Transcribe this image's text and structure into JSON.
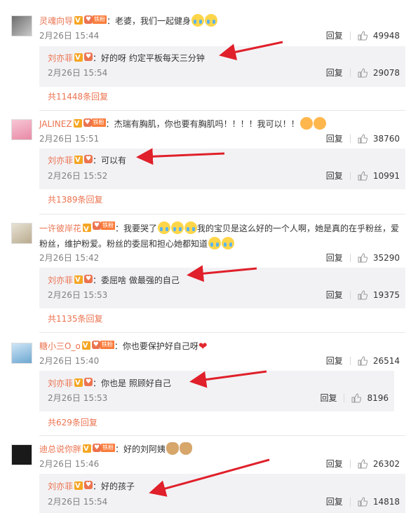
{
  "comments": [
    {
      "user": "灵魂向导",
      "sep": "：",
      "text": "老婆，我们一起健身",
      "emojis": [
        "cry",
        "cry"
      ],
      "time": "2月26日 15:44",
      "reply_label": "回复",
      "likes": "49948",
      "sub": {
        "user": "刘亦菲",
        "sep": "：",
        "text": "好的呀 约定平板每天三分钟",
        "time": "2月26日 15:54",
        "reply_label": "回复",
        "likes": "29078"
      },
      "more": "共11448条回复"
    },
    {
      "user": "JALINEZ",
      "sep": "：",
      "text": "杰瑞有胸肌，你也要有胸肌吗！！！！我可以！！",
      "emojis": [
        "sleep",
        "sleep"
      ],
      "time": "2月26日 15:51",
      "reply_label": "回复",
      "likes": "38760",
      "sub": {
        "user": "刘亦菲",
        "sep": "：",
        "text": "可以有",
        "time": "2月26日 15:52",
        "reply_label": "回复",
        "likes": "10991"
      },
      "more": "共1389条回复"
    },
    {
      "user": "一许彼岸花",
      "sep": "：",
      "text_a": "我要哭了",
      "text_b": "我的宝贝是这么好的一个人啊，她是真的在乎粉丝，爱粉丝，维护粉爱。粉丝的委屈和担心她都知道",
      "time": "2月26日 15:42",
      "reply_label": "回复",
      "likes": "35290",
      "sub": {
        "user": "刘亦菲",
        "sep": "：",
        "text": "委屈啥 做最强的自己",
        "time": "2月26日 15:53",
        "reply_label": "回复",
        "likes": "19375"
      },
      "more": "共1135条回复"
    },
    {
      "user": "糖小三O_o",
      "sep": "：",
      "text": "你也要保护好自己呀",
      "time": "2月26日 15:40",
      "reply_label": "回复",
      "likes": "26514",
      "sub": {
        "user": "刘亦菲",
        "sep": "：",
        "text": "你也是 照顾好自己",
        "time": "2月26日 15:53",
        "reply_label": "回复",
        "likes": "8196"
      },
      "more": "共629条回复"
    },
    {
      "user": "迪总说你胖",
      "sep": "：",
      "text": "好的刘阿姨",
      "time": "2月26日 15:46",
      "reply_label": "回复",
      "likes": "26302",
      "sub": {
        "user": "刘亦菲",
        "sep": "：",
        "text": "好的孩子",
        "time": "2月26日 15:54",
        "reply_label": "回复",
        "likes": "14818"
      }
    }
  ],
  "badges": {
    "fan_tag": "铁粉",
    "verified_icon": "verified-v-icon",
    "heart_icon": "fan-heart-icon",
    "thumb_icon": "thumbs-up-icon"
  },
  "colors": {
    "username": "#eb7350",
    "subbox_bg": "#f2f2f5",
    "annotation_arrow": "#e0202a"
  }
}
